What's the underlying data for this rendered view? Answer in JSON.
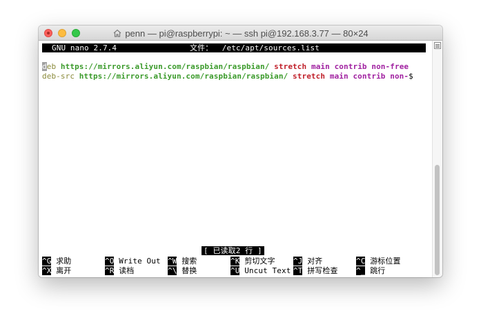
{
  "window": {
    "title": "penn — pi@raspberrypi: ~ — ssh pi@192.168.3.77 — 80×24",
    "home_icon": "home-icon"
  },
  "nano": {
    "version": "GNU nano 2.7.4",
    "file_label": "文件：",
    "file_path": "/etc/apt/sources.list",
    "lines": [
      {
        "cursor_char": "d",
        "type": "eb",
        "url": "https://mirrors.aliyun.com/raspbian/raspbian/",
        "suite": "stretch",
        "components": "main contrib non-free"
      },
      {
        "type": "deb-src",
        "url": "https://mirrors.aliyun.com/raspbian/raspbian/",
        "suite": "stretch",
        "components": "main contrib non-",
        "overflow": "$"
      }
    ],
    "status": "[ 已读取2 行 ]",
    "shortcuts": [
      [
        {
          "key": "^G",
          "label": "求助"
        },
        {
          "key": "^O",
          "label": "Write Out"
        },
        {
          "key": "^W",
          "label": "搜索"
        },
        {
          "key": "^K",
          "label": "剪切文字"
        },
        {
          "key": "^J",
          "label": "对齐"
        },
        {
          "key": "^C",
          "label": "游标位置"
        }
      ],
      [
        {
          "key": "^X",
          "label": "离开"
        },
        {
          "key": "^R",
          "label": "读档"
        },
        {
          "key": "^\\",
          "label": "替换"
        },
        {
          "key": "^U",
          "label": "Uncut Text"
        },
        {
          "key": "^T",
          "label": "拼写检查"
        },
        {
          "key": "^_",
          "label": "跳行"
        }
      ]
    ]
  },
  "colors": {
    "keyword": "#8a8a3a",
    "url": "#3a9a2a",
    "suite": "#c0202a",
    "components": "#a020a0"
  }
}
